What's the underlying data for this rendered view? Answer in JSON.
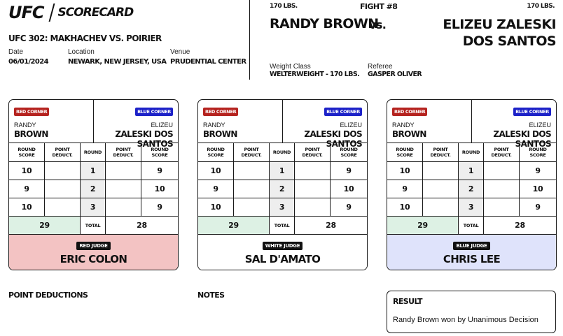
{
  "header": {
    "logo_text": "UFC",
    "title": "SCORECARD",
    "event": "UFC 302: MAKHACHEV VS. POIRIER",
    "date_label": "Date",
    "date": "06/01/2024",
    "location_label": "Location",
    "location": "NEWARK, NEW JERSEY, USA",
    "venue_label": "Venue",
    "venue": "PRUDENTIAL CENTER"
  },
  "fight": {
    "number": "FIGHT #8",
    "red_weight": "170 LBS.",
    "blue_weight": "170 LBS.",
    "red_fighter": "RANDY BROWN",
    "vs": "vs.",
    "blue_fighter": "ELIZEU ZALESKI DOS SANTOS",
    "weight_class_label": "Weight Class",
    "weight_class": "WELTERWEIGHT - 170 LBS.",
    "referee_label": "Referee",
    "referee": "GASPER OLIVER"
  },
  "labels": {
    "red_corner": "RED CORNER",
    "blue_corner": "BLUE CORNER",
    "round_score": "ROUND SCORE",
    "point_deduct": "POINT DEDUCT.",
    "round": "ROUND",
    "total": "TOTAL"
  },
  "cards": [
    {
      "red_first": "RANDY",
      "red_last": "BROWN",
      "blue_first": "ELIZEU",
      "blue_last": "ZALESKI DOS SANTOS",
      "rounds": [
        {
          "round": "1",
          "red": "10",
          "red_deduct": "",
          "blue_deduct": "",
          "blue": "9"
        },
        {
          "round": "2",
          "red": "9",
          "red_deduct": "",
          "blue_deduct": "",
          "blue": "10"
        },
        {
          "round": "3",
          "red": "10",
          "red_deduct": "",
          "blue_deduct": "",
          "blue": "9"
        }
      ],
      "red_total": "29",
      "blue_total": "28",
      "judge_badge": "RED JUDGE",
      "judge_name": "ERIC COLON"
    },
    {
      "red_first": "RANDY",
      "red_last": "BROWN",
      "blue_first": "ELIZEU",
      "blue_last": "ZALESKI DOS SANTOS",
      "rounds": [
        {
          "round": "1",
          "red": "10",
          "red_deduct": "",
          "blue_deduct": "",
          "blue": "9"
        },
        {
          "round": "2",
          "red": "9",
          "red_deduct": "",
          "blue_deduct": "",
          "blue": "10"
        },
        {
          "round": "3",
          "red": "10",
          "red_deduct": "",
          "blue_deduct": "",
          "blue": "9"
        }
      ],
      "red_total": "29",
      "blue_total": "28",
      "judge_badge": "WHITE JUDGE",
      "judge_name": "SAL D'AMATO"
    },
    {
      "red_first": "RANDY",
      "red_last": "BROWN",
      "blue_first": "ELIZEU",
      "blue_last": "ZALESKI DOS SANTOS",
      "rounds": [
        {
          "round": "1",
          "red": "10",
          "red_deduct": "",
          "blue_deduct": "",
          "blue": "9"
        },
        {
          "round": "2",
          "red": "9",
          "red_deduct": "",
          "blue_deduct": "",
          "blue": "10"
        },
        {
          "round": "3",
          "red": "10",
          "red_deduct": "",
          "blue_deduct": "",
          "blue": "9"
        }
      ],
      "red_total": "29",
      "blue_total": "28",
      "judge_badge": "BLUE JUDGE",
      "judge_name": "CHRIS LEE"
    }
  ],
  "bottom": {
    "point_deductions_label": "POINT DEDUCTIONS",
    "notes_label": "NOTES",
    "result_label": "RESULT",
    "result_text": "Randy Brown won by Unanimous Decision"
  },
  "colors": {
    "red_corner": "#b5231f",
    "blue_corner": "#1d22c8",
    "red_judge_bg": "#f3c3c3",
    "blue_judge_bg": "#dfe3fb",
    "total_bg": "#ddf1e4"
  }
}
